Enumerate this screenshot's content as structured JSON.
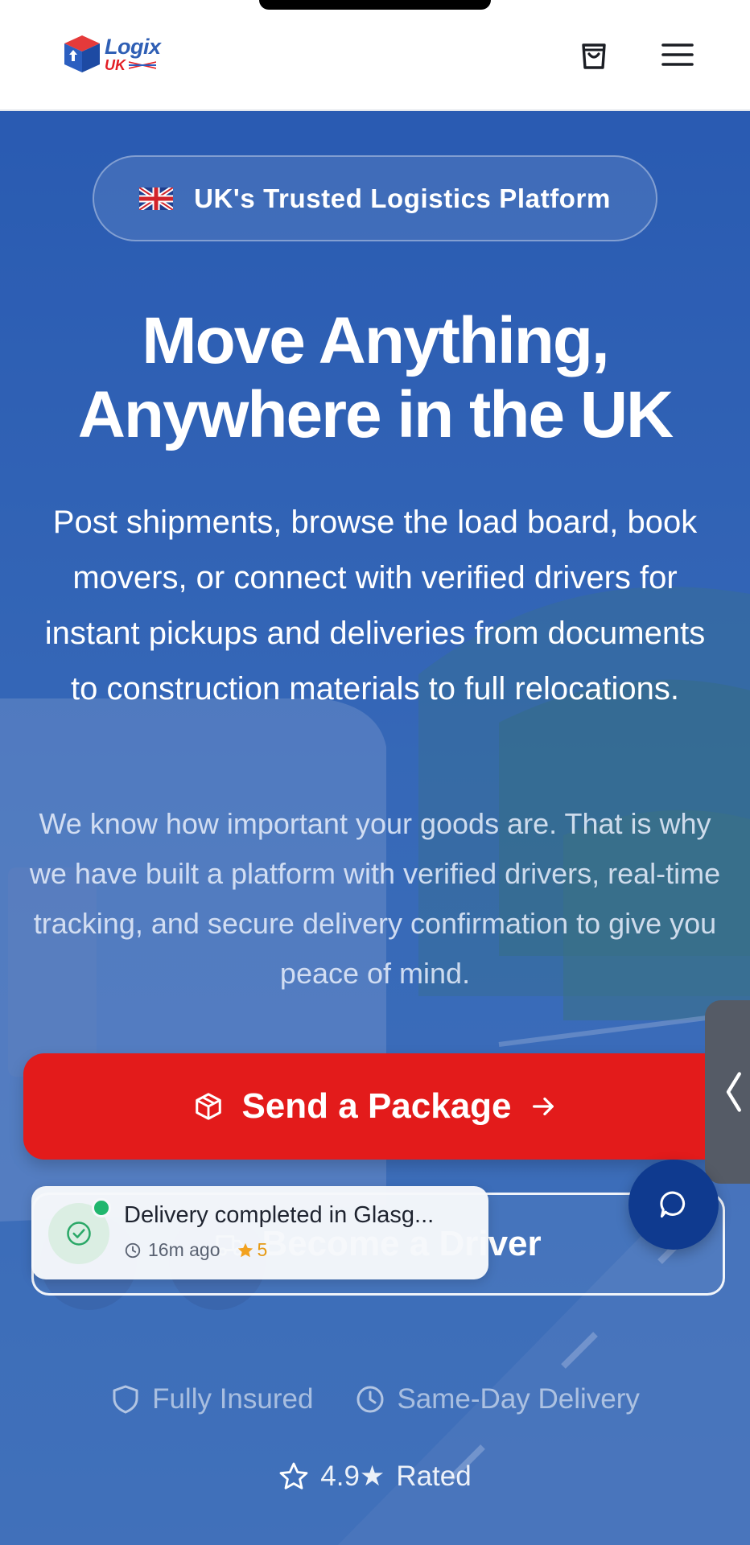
{
  "header": {
    "logo_word": "Logix",
    "logo_suffix": "UK",
    "cart_icon": "shopping-bag-icon",
    "menu_icon": "hamburger-menu-icon"
  },
  "hero": {
    "badge_text": "UK's Trusted Logistics Platform",
    "headline_line1": "Move Anything,",
    "headline_line2": "Anywhere in the UK",
    "subhead": "Post shipments, browse the load board, book movers, or connect with verified drivers for instant pickups and deliveries from documents to construction materials to full relocations.",
    "paragraph": "We know how important your goods are. That is why we have built a platform with verified drivers, real-time tracking, and secure delivery confirmation to give you peace of mind.",
    "primary_button": "Send a Package",
    "secondary_button": "Become a Driver",
    "features": [
      "Fully Insured",
      "Same-Day Delivery"
    ],
    "rating_value": "4.9★",
    "rating_label": "Rated"
  },
  "toast": {
    "title": "Delivery completed in Glasg...",
    "time": "16m ago",
    "stars": "5"
  },
  "colors": {
    "brand_blue": "#2f5fb5",
    "brand_red": "#e31b1b",
    "chat_button": "#0f3a8f",
    "success_green": "#1fb66d"
  }
}
